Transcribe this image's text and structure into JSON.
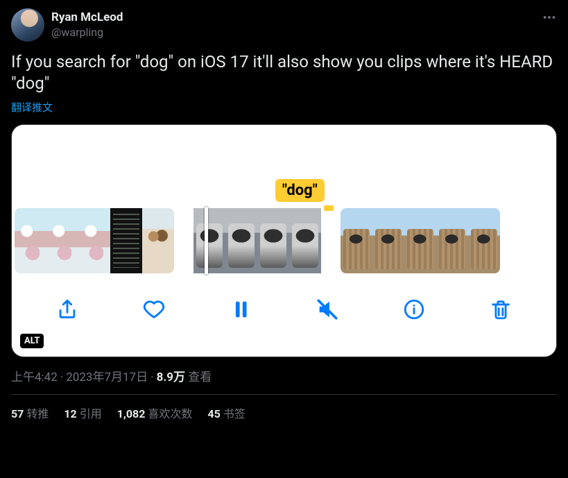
{
  "author": {
    "display_name": "Ryan McLeod",
    "handle": "@warpling"
  },
  "tweet_text": "If you search for \"dog\" on iOS 17 it'll also show you clips where it's HEARD \"dog\"",
  "translate_label": "翻译推文",
  "media": {
    "caption_label": "\"dog\"",
    "alt_badge": "ALT"
  },
  "meta": {
    "time": "上午4:42",
    "date": "2023年7月17日",
    "views_count": "8.9万",
    "views_label": "查看"
  },
  "stats": {
    "retweets_count": "57",
    "retweets_label": "转推",
    "quotes_count": "12",
    "quotes_label": "引用",
    "likes_count": "1,082",
    "likes_label": "喜欢次数",
    "bookmarks_count": "45",
    "bookmarks_label": "书签"
  }
}
